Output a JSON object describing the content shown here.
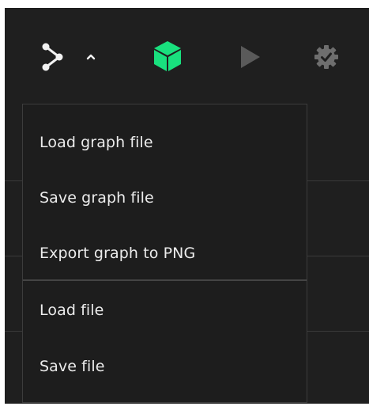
{
  "toolbar": {
    "buttons": [
      {
        "icon": "graph-nodes-icon"
      },
      {
        "icon": "chevron-up-icon"
      },
      {
        "icon": "cube-icon",
        "color": "#19e07e"
      },
      {
        "icon": "play-icon",
        "color": "#5a5a5a"
      },
      {
        "icon": "gear-check-icon",
        "color": "#6e6e6e"
      }
    ]
  },
  "menu": {
    "group1": [
      {
        "label": "Load graph file"
      },
      {
        "label": "Save graph file"
      },
      {
        "label": "Export graph to PNG"
      }
    ],
    "group2": [
      {
        "label": "Load file"
      },
      {
        "label": "Save file"
      }
    ]
  },
  "colors": {
    "background": "#1f1f1f",
    "menu_bg": "#1d1d1d",
    "text": "#ececec",
    "accent": "#19e07e"
  }
}
